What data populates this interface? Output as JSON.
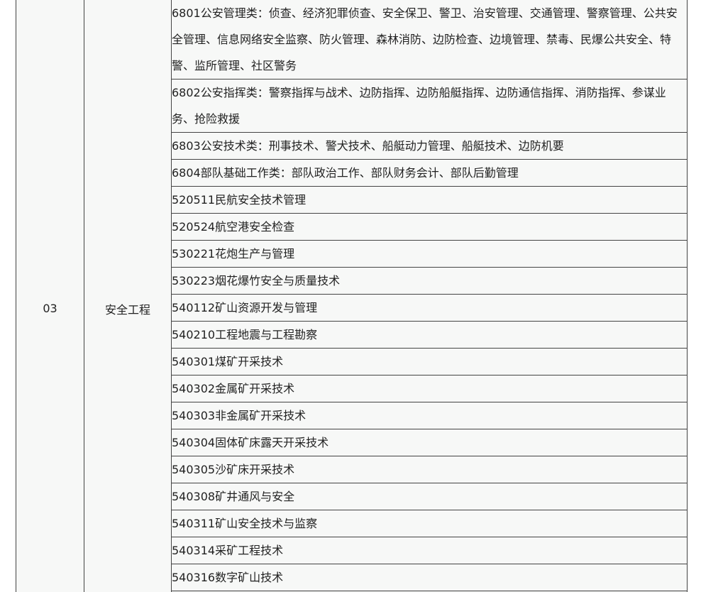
{
  "table": {
    "code": "03",
    "category": "安全工程",
    "majors": [
      "6801公安管理类：侦查、经济犯罪侦查、安全保卫、警卫、治安管理、交通管理、警察管理、公共安全管理、信息网络安全监察、防火管理、森林消防、边防检查、边境管理、禁毒、民爆公共安全、特警、监所管理、社区警务",
      "6802公安指挥类：警察指挥与战术、边防指挥、边防船艇指挥、边防通信指挥、消防指挥、参谋业务、抢险救援",
      "6803公安技术类：刑事技术、警犬技术、船艇动力管理、船艇技术、边防机要",
      "6804部队基础工作类：部队政治工作、部队财务会计、部队后勤管理",
      "520511民航安全技术管理",
      "520524航空港安全检查",
      "530221花炮生产与管理",
      "530223烟花爆竹安全与质量技术",
      "540112矿山资源开发与管理",
      "540210工程地震与工程勘察",
      "540301煤矿开采技术",
      "540302金属矿开采技术",
      "540303非金属矿开采技术",
      "540304固体矿床露天开采技术",
      "540305沙矿床开采技术",
      "540308矿井通风与安全",
      "540311矿山安全技术与监察",
      "540314采矿工程技术",
      "540316数字矿山技术",
      ""
    ]
  }
}
